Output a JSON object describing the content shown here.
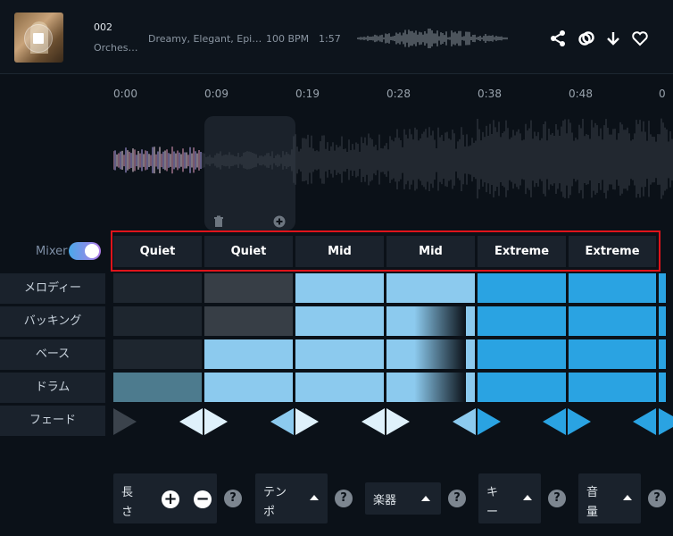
{
  "track": {
    "number": "002",
    "genre": "Orches…",
    "tags": "Dreamy, Elegant, Epi…",
    "bpm": "100 BPM",
    "length": "1:57"
  },
  "timeline": {
    "ticks": [
      "0:00",
      "0:09",
      "0:19",
      "0:28",
      "0:38",
      "0:48",
      "0"
    ]
  },
  "mixer": {
    "label": "Mixer",
    "enabled": true
  },
  "energy_segments": [
    "Quiet",
    "Quiet",
    "Mid",
    "Mid",
    "Extreme",
    "Extreme"
  ],
  "tracks": [
    {
      "label": "メロディー"
    },
    {
      "label": "バッキング"
    },
    {
      "label": "ベース"
    },
    {
      "label": "ドラム"
    },
    {
      "label": "フェード"
    }
  ],
  "controls": {
    "length": {
      "label_top": "長",
      "label_bottom": "さ",
      "plus": "+",
      "minus": "−"
    },
    "tempo": {
      "label_top": "テン",
      "label_bottom": "ポ"
    },
    "instrument": {
      "label": "楽器"
    },
    "key": {
      "label_top": "キ",
      "label_bottom": "ー"
    },
    "volume": {
      "label_top": "音",
      "label_bottom": "量"
    },
    "help": "?"
  },
  "colors": {
    "accent_red": "#e0141b",
    "cell_off": "#1e262f",
    "cell_low": "#373e46",
    "cell_mid": "#8ccaee",
    "cell_high": "#2aa3e2",
    "cell_drum_low": "#4d7b8e"
  }
}
